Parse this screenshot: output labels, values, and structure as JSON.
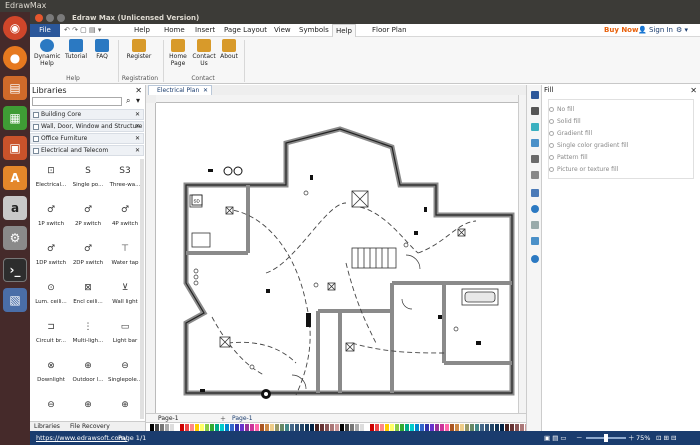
{
  "os": {
    "title": "EdrawMax"
  },
  "window": {
    "title": "Edraw Max (Unlicensed Version)"
  },
  "menu": {
    "file": "File",
    "help_menu": "Help",
    "home": "Home",
    "insert": "Insert",
    "page_layout": "Page Layout",
    "view": "View",
    "symbols": "Symbols",
    "help": "Help",
    "floor_plan": "Floor Plan",
    "buy_now": "Buy Now",
    "sign_in": "Sign In"
  },
  "ribbon": {
    "dynamic_help_1": "Dynamic",
    "dynamic_help_2": "Help",
    "tutorial": "Tutorial",
    "faq": "FAQ",
    "group_help": "Help",
    "register": "Register",
    "group_registration": "Registration",
    "home_page_1": "Home",
    "home_page_2": "Page",
    "contact_us_1": "Contact",
    "contact_us_2": "Us",
    "about": "About",
    "group_contact": "Contact"
  },
  "libraries": {
    "title": "Libraries",
    "categories": [
      "Building Core",
      "Wall, Door, Window and Structure",
      "Office Furniture",
      "Electrical and Telecom"
    ],
    "shapes": [
      {
        "label": "Electrical...",
        "glyph": "⊡"
      },
      {
        "label": "Single po...",
        "glyph": "S"
      },
      {
        "label": "Three-wa...",
        "glyph": "S3"
      },
      {
        "label": "1P switch",
        "glyph": "♂"
      },
      {
        "label": "2P switch",
        "glyph": "♂"
      },
      {
        "label": "4P switch",
        "glyph": "♂"
      },
      {
        "label": "1DP switch",
        "glyph": "♂"
      },
      {
        "label": "2DP switch",
        "glyph": "♂"
      },
      {
        "label": "Water tap",
        "glyph": "⊤"
      },
      {
        "label": "Lum. ceili...",
        "glyph": "⊙"
      },
      {
        "label": "Encl ceili...",
        "glyph": "⊠"
      },
      {
        "label": "Wall light",
        "glyph": "⊻"
      },
      {
        "label": "Circuit br...",
        "glyph": "⊐"
      },
      {
        "label": "Multi-ligh...",
        "glyph": "⋮"
      },
      {
        "label": "Light bar",
        "glyph": "▭"
      },
      {
        "label": "Downlight",
        "glyph": "⊗"
      },
      {
        "label": "Outdoor l...",
        "glyph": "⊕"
      },
      {
        "label": "Singlepole...",
        "glyph": "⊖"
      },
      {
        "label": "",
        "glyph": "⊖"
      },
      {
        "label": "",
        "glyph": "⊕"
      },
      {
        "label": "",
        "glyph": "⊕"
      }
    ],
    "tab_libraries": "Libraries",
    "tab_file_recovery": "File Recovery"
  },
  "document": {
    "tab": "Electrical Plan",
    "page_tab": "Page-1",
    "page_tab_active": "Page-1",
    "sd_label": "SD"
  },
  "fill": {
    "title": "Fill",
    "options": [
      "No fill",
      "Solid fill",
      "Gradient fill",
      "Single color gradient fill",
      "Pattern fill",
      "Picture or texture fill"
    ]
  },
  "status": {
    "url": "https://www.edrawsoft.com/",
    "page": "Page 1/1",
    "zoom": "75%"
  },
  "colors": {
    "accent": "#1a3c6e",
    "file_tab": "#2b579a",
    "buy": "#e8600a"
  }
}
